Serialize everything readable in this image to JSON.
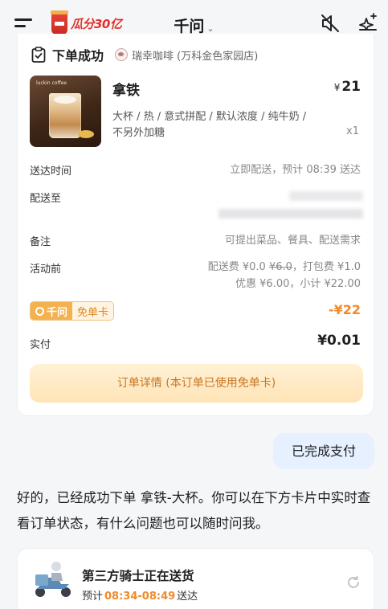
{
  "header": {
    "promo_text": "瓜分30亿",
    "title": "千问",
    "title_chevron": "⌄"
  },
  "order": {
    "status": "下单成功",
    "store": "瑞幸咖啡 (万科金色家园店)",
    "product": {
      "image_brand": "luckin coffee",
      "name": "拿铁",
      "currency": "¥",
      "price": "21",
      "spec": "大杯 / 热 / 意式拼配 / 默认浓度 / 纯牛奶 / 不另外加糖",
      "qty": "x1"
    },
    "delivery_time_label": "送达时间",
    "delivery_time_value": "立即配送，预计 08:39 送达",
    "address_label": "配送至",
    "remark_label": "备注",
    "remark_value": "可提出菜品、餐具、配送需求",
    "promo_label": "活动前",
    "fee_line": {
      "prefix": "配送费 ¥0.0 ",
      "struck": "¥6.0",
      "suffix": "，打包费 ¥1.0"
    },
    "discount_line": "优惠 ¥6.00，小计 ¥22.00",
    "coupon_brand": "千问",
    "coupon_name": "免单卡",
    "coupon_amount": "-¥22",
    "paid_label": "实付",
    "paid_amount": "¥0.01",
    "detail_button": "订单详情 (本订单已使用免单卡)"
  },
  "chat": {
    "user_message": "已完成支付",
    "ai_reply": "好的，已经成功下单 拿铁-大杯。你可以在下方卡片中实时查看订单状态，有什么问题也可以随时问我。"
  },
  "delivery": {
    "title": "第三方骑士正在送货",
    "eta_prefix": "预计",
    "eta_time": "08:34-08:49",
    "eta_suffix": "送达"
  },
  "colors": {
    "accent_orange": "#f08a2a",
    "user_bubble": "#e6f0ff",
    "coupon_gold": "#f3b24f"
  },
  "icons": [
    "menu-icon",
    "promo-cup-icon",
    "mute-icon",
    "sparkle-add-icon",
    "clipboard-check-icon",
    "store-logo-icon",
    "rider-icon",
    "refresh-icon"
  ]
}
